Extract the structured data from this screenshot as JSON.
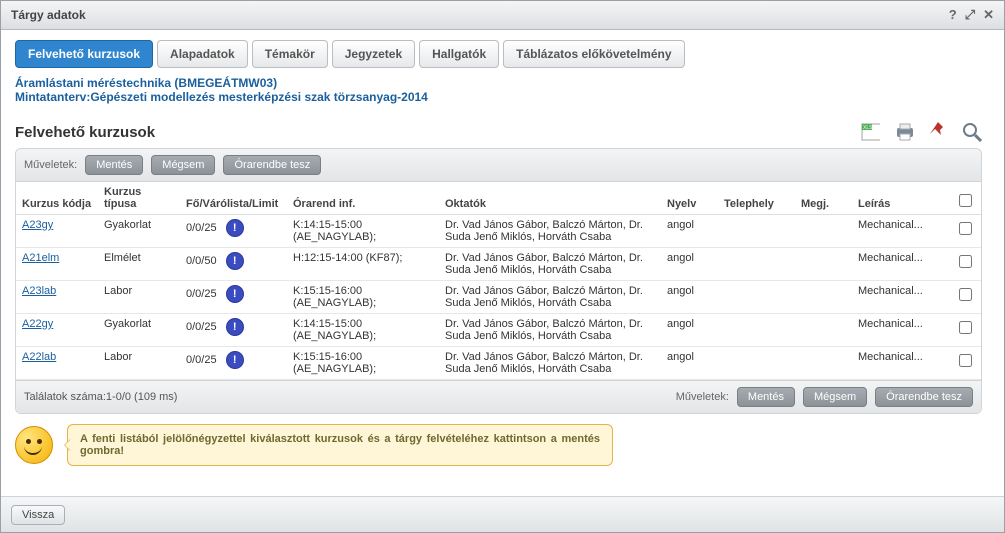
{
  "window": {
    "title": "Tárgy adatok"
  },
  "tabs": [
    {
      "label": "Felvehető kurzusok",
      "active": true
    },
    {
      "label": "Alapadatok",
      "active": false
    },
    {
      "label": "Témakör",
      "active": false
    },
    {
      "label": "Jegyzetek",
      "active": false
    },
    {
      "label": "Hallgatók",
      "active": false
    },
    {
      "label": "Táblázatos előkövetelmény",
      "active": false
    }
  ],
  "header_links": {
    "line1": "Áramlástani méréstechnika (BMEGEÁTMW03)",
    "line2": "Mintatanterv:Gépészeti modellezés mesterképzési szak törzsanyag-2014"
  },
  "section_title": "Felvehető kurzusok",
  "ops": {
    "label": "Műveletek:",
    "save": "Mentés",
    "cancel": "Mégsem",
    "schedule": "Órarendbe tesz"
  },
  "columns": {
    "code": "Kurzus kódja",
    "type": "Kurzus típusa",
    "limit": "Fő/Várólista/Limit",
    "time": "Órarend inf.",
    "teachers": "Oktatók",
    "lang": "Nyelv",
    "site": "Telephely",
    "note": "Megj.",
    "desc": "Leírás"
  },
  "rows": [
    {
      "code": "A23gy",
      "type": "Gyakorlat",
      "limit": "0/0/25",
      "time": "K:14:15-15:00 (AE_NAGYLAB);",
      "teachers": "Dr. Vad János Gábor, Balczó Márton, Dr. Suda Jenő Miklós, Horváth Csaba",
      "lang": "angol",
      "desc": "Mechanical..."
    },
    {
      "code": "A21elm",
      "type": "Elmélet",
      "limit": "0/0/50",
      "time": "H:12:15-14:00 (KF87);",
      "teachers": "Dr. Vad János Gábor, Balczó Márton, Dr. Suda Jenő Miklós, Horváth Csaba",
      "lang": "angol",
      "desc": "Mechanical..."
    },
    {
      "code": "A23lab",
      "type": "Labor",
      "limit": "0/0/25",
      "time": "K:15:15-16:00 (AE_NAGYLAB);",
      "teachers": "Dr. Vad János Gábor, Balczó Márton, Dr. Suda Jenő Miklós, Horváth Csaba",
      "lang": "angol",
      "desc": "Mechanical..."
    },
    {
      "code": "A22gy",
      "type": "Gyakorlat",
      "limit": "0/0/25",
      "time": "K:14:15-15:00 (AE_NAGYLAB);",
      "teachers": "Dr. Vad János Gábor, Balczó Márton, Dr. Suda Jenő Miklós, Horváth Csaba",
      "lang": "angol",
      "desc": "Mechanical..."
    },
    {
      "code": "A22lab",
      "type": "Labor",
      "limit": "0/0/25",
      "time": "K:15:15-16:00 (AE_NAGYLAB);",
      "teachers": "Dr. Vad János Gábor, Balczó Márton, Dr. Suda Jenő Miklós, Horváth Csaba",
      "lang": "angol",
      "desc": "Mechanical..."
    }
  ],
  "footer_count": "Találatok száma:1-0/0 (109 ms)",
  "hint": "A fenti listából jelölőnégyzettel kiválasztott kurzusok és a tárgy felvételéhez kattintson a mentés gombra!",
  "back": "Vissza"
}
